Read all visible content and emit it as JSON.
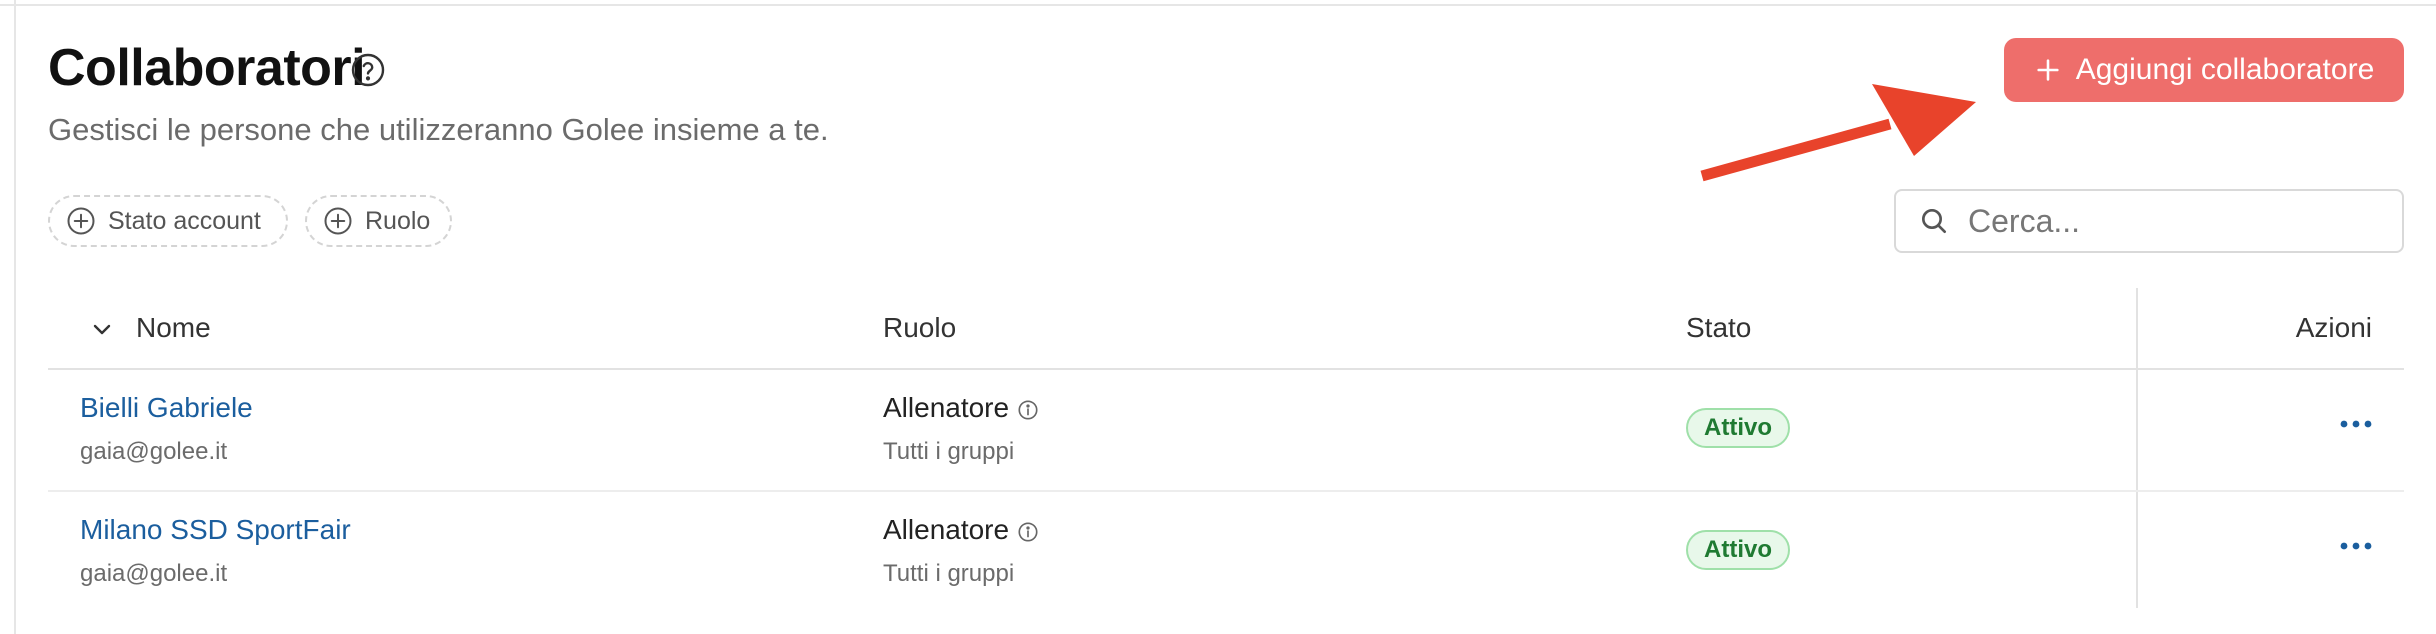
{
  "header": {
    "title": "Collaboratori",
    "subtitle": "Gestisci le persone che utilizzeranno Golee insieme a te.",
    "add_button_label": "Aggiungi collaboratore"
  },
  "filters": [
    {
      "label": "Stato account"
    },
    {
      "label": "Ruolo"
    }
  ],
  "search": {
    "placeholder": "Cerca..."
  },
  "table": {
    "columns": {
      "name": "Nome",
      "role": "Ruolo",
      "status": "Stato",
      "actions": "Azioni"
    },
    "rows": [
      {
        "name": "Bielli Gabriele",
        "email": "gaia@golee.it",
        "role": "Allenatore",
        "scope": "Tutti i gruppi",
        "status": "Attivo"
      },
      {
        "name": "Milano SSD SportFair",
        "email": "gaia@golee.it",
        "role": "Allenatore",
        "scope": "Tutti i gruppi",
        "status": "Attivo"
      }
    ]
  },
  "colors": {
    "accent": "#ee6e6b",
    "arrow": "#e8432b",
    "link": "#1b5e9e",
    "status_active": "#1f7a32"
  },
  "icons": [
    "help-circle-icon",
    "plus-icon",
    "plus-circle-icon",
    "search-icon",
    "chevron-down-icon",
    "info-icon",
    "more-horizontal-icon"
  ]
}
